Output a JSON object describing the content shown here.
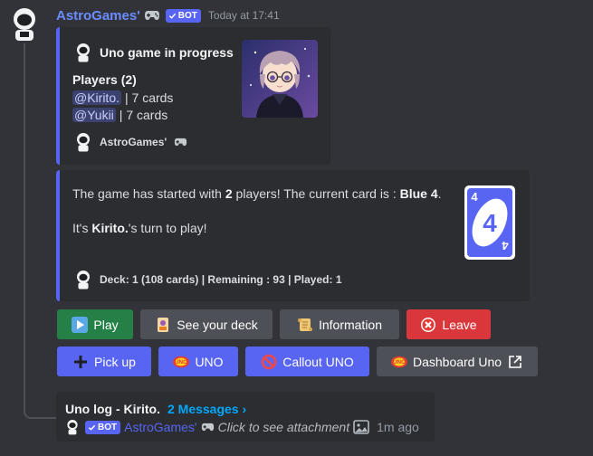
{
  "message": {
    "author": "AstroGames'",
    "bot_badge": "BOT",
    "timestamp": "Today at 17:41"
  },
  "embed1": {
    "author": "Uno game in progress",
    "field_title": "Players (2)",
    "players": [
      {
        "mention": "@Kirito.",
        "cards": "| 7 cards"
      },
      {
        "mention": "@Yukii",
        "cards": "| 7 cards"
      }
    ],
    "footer": "AstroGames'"
  },
  "embed2": {
    "desc_pre": "The game has started with ",
    "desc_count": "2",
    "desc_mid": " players! The current card is : ",
    "desc_card": "Blue 4",
    "desc_end": ".",
    "turn_pre": "It's ",
    "turn_name": "Kirito.",
    "turn_post": "'s turn to play!",
    "card_value": "4",
    "footer": "Deck: 1 (108 cards) | Remaining : 93 | Played: 1"
  },
  "buttons": {
    "play": "Play",
    "see_deck": "See your deck",
    "information": "Information",
    "leave": "Leave",
    "pick_up": "Pick up",
    "uno": "UNO",
    "callout": "Callout UNO",
    "dashboard": "Dashboard Uno"
  },
  "uno_logo_text": "UNO",
  "thread": {
    "title": "Uno log - Kirito.",
    "count": "2 Messages ›",
    "bot_badge": "BOT",
    "author": "AstroGames'",
    "preview": "Click to see attachment",
    "time": "1m ago"
  },
  "colors": {
    "background": "#313338",
    "embed": "#2b2d31",
    "accent": "#5865f2",
    "green": "#248046",
    "red": "#da373c",
    "grey": "#4e5058",
    "card_blue": "#5865f2"
  }
}
